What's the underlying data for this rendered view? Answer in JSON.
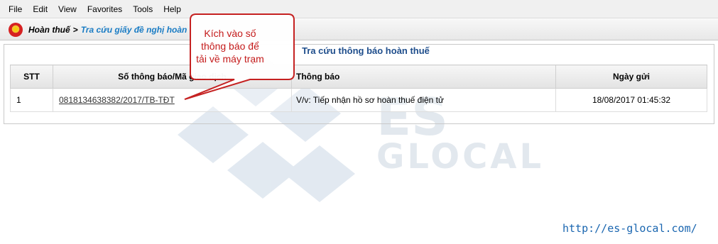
{
  "menu": {
    "items": [
      "File",
      "Edit",
      "View",
      "Favorites",
      "Tools",
      "Help"
    ]
  },
  "breadcrumb": {
    "home": "Hoàn thuế",
    "separator": ">",
    "current": "Tra cứu giấy đề nghị hoàn"
  },
  "page": {
    "title": "Tra cứu thông báo hoàn thuế"
  },
  "table": {
    "headers": {
      "stt": "STT",
      "so_thong_bao": "Số thông báo/Mã giao dịch",
      "thong_bao": "Thông báo",
      "ngay_gui": "Ngày gửi"
    },
    "rows": [
      {
        "stt": "1",
        "so_thong_bao": "0818134638382/2017/TB-TĐT",
        "thong_bao": "V/v: Tiếp nhận hồ sơ hoàn thuế điện tử",
        "ngay_gui": "18/08/2017 01:45:32"
      }
    ]
  },
  "callout": {
    "line1": "Kích vào số",
    "line2": "thông báo để",
    "line3": "tải về máy trạm"
  },
  "watermark": {
    "brand_line1": "ES",
    "brand_line2": "GLOCAL",
    "url": "http://es-glocal.com/"
  },
  "colors": {
    "title_blue": "#1f4e8c",
    "breadcrumb_blue": "#1a7cc4",
    "callout_red": "#c41b1b",
    "watermark_blue": "#1a66b0"
  }
}
